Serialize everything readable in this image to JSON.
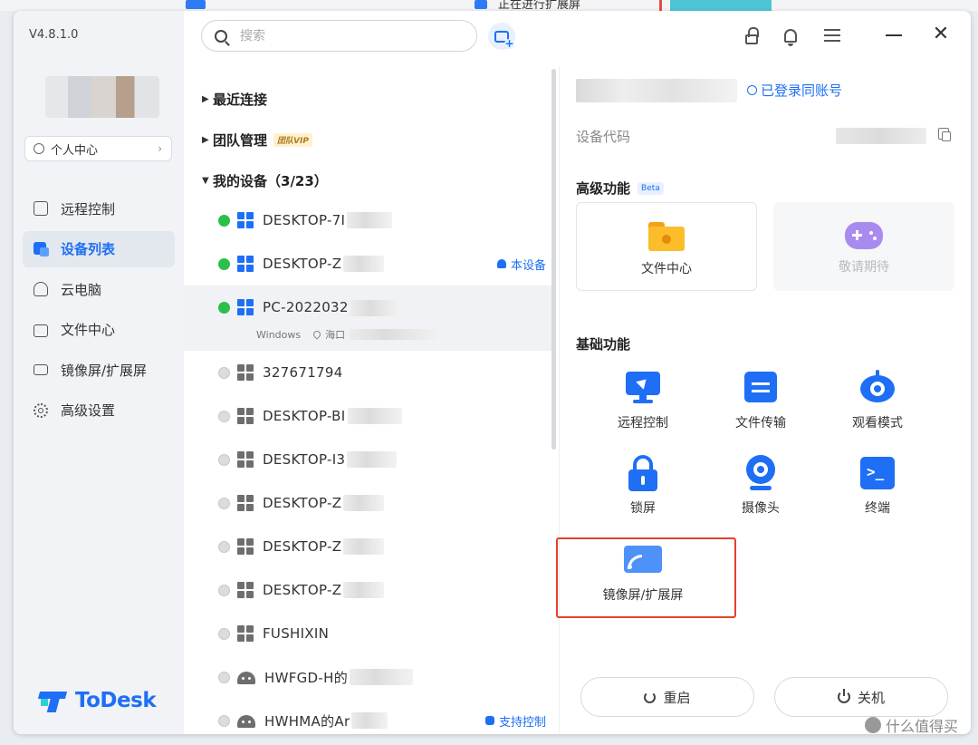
{
  "app": {
    "version": "V4.8.1.0",
    "logo_text": "ToDesk"
  },
  "background": {
    "task_text": "正在进行扩展屏"
  },
  "sidebar": {
    "profile_label": "个人中心",
    "items": [
      {
        "label": "远程控制",
        "icon": "monitor-icon",
        "active": false
      },
      {
        "label": "设备列表",
        "icon": "device-list-icon",
        "active": true
      },
      {
        "label": "云电脑",
        "icon": "cloud-pc-icon",
        "active": false
      },
      {
        "label": "文件中心",
        "icon": "folder-icon",
        "active": false
      },
      {
        "label": "镜像屏/扩展屏",
        "icon": "cast-icon",
        "active": false
      },
      {
        "label": "高级设置",
        "icon": "gear-icon",
        "active": false
      }
    ]
  },
  "toolbar": {
    "search_placeholder": "搜索"
  },
  "device_list": {
    "groups": [
      {
        "label": "最近连接",
        "expanded": false
      },
      {
        "label": "团队管理",
        "badge": "团队VIP",
        "expanded": false
      },
      {
        "label": "我的设备（3/23）",
        "expanded": true
      }
    ],
    "devices": [
      {
        "name": "DESKTOP-7I",
        "online": true,
        "os": "windows"
      },
      {
        "name": "DESKTOP-Z",
        "online": true,
        "os": "windows",
        "tag": "本设备"
      },
      {
        "name": "PC-2022032",
        "online": true,
        "os": "windows",
        "selected": true,
        "sub_os": "Windows",
        "sub_location": "海口"
      },
      {
        "name": "327671794",
        "online": false,
        "os": "windows"
      },
      {
        "name": "DESKTOP-BI",
        "online": false,
        "os": "windows"
      },
      {
        "name": "DESKTOP-I3",
        "online": false,
        "os": "windows"
      },
      {
        "name": "DESKTOP-Z",
        "online": false,
        "os": "windows"
      },
      {
        "name": "DESKTOP-Z",
        "online": false,
        "os": "windows"
      },
      {
        "name": "DESKTOP-Z",
        "online": false,
        "os": "windows"
      },
      {
        "name": "FUSHIXIN",
        "online": false,
        "os": "windows"
      },
      {
        "name": "HWFGD-H的",
        "online": false,
        "os": "android"
      },
      {
        "name": "HWHMA的Ar",
        "online": false,
        "os": "android",
        "tag": "支持控制"
      }
    ]
  },
  "detail": {
    "logged_in_label": "已登录同账号",
    "device_code_label": "设备代码",
    "advanced_title": "高级功能",
    "beta_label": "Beta",
    "advanced": [
      {
        "label": "文件中心",
        "icon": "folder-icon",
        "disabled": false
      },
      {
        "label": "敬请期待",
        "icon": "gamepad-icon",
        "disabled": true
      }
    ],
    "basic_title": "基础功能",
    "basic": [
      {
        "label": "远程控制",
        "icon": "remote-control-icon"
      },
      {
        "label": "文件传输",
        "icon": "file-transfer-icon"
      },
      {
        "label": "观看模式",
        "icon": "eye-icon"
      },
      {
        "label": "锁屏",
        "icon": "lock-icon"
      },
      {
        "label": "摄像头",
        "icon": "camera-icon"
      },
      {
        "label": "终端",
        "icon": "terminal-icon"
      },
      {
        "label": "镜像屏/扩展屏",
        "icon": "cast-icon",
        "highlighted": true
      }
    ],
    "restart_label": "重启",
    "shutdown_label": "关机"
  },
  "watermark": "什么值得买",
  "colors": {
    "accent": "#1e6ff5",
    "online": "#2bc04a",
    "highlight": "#e4412b"
  }
}
